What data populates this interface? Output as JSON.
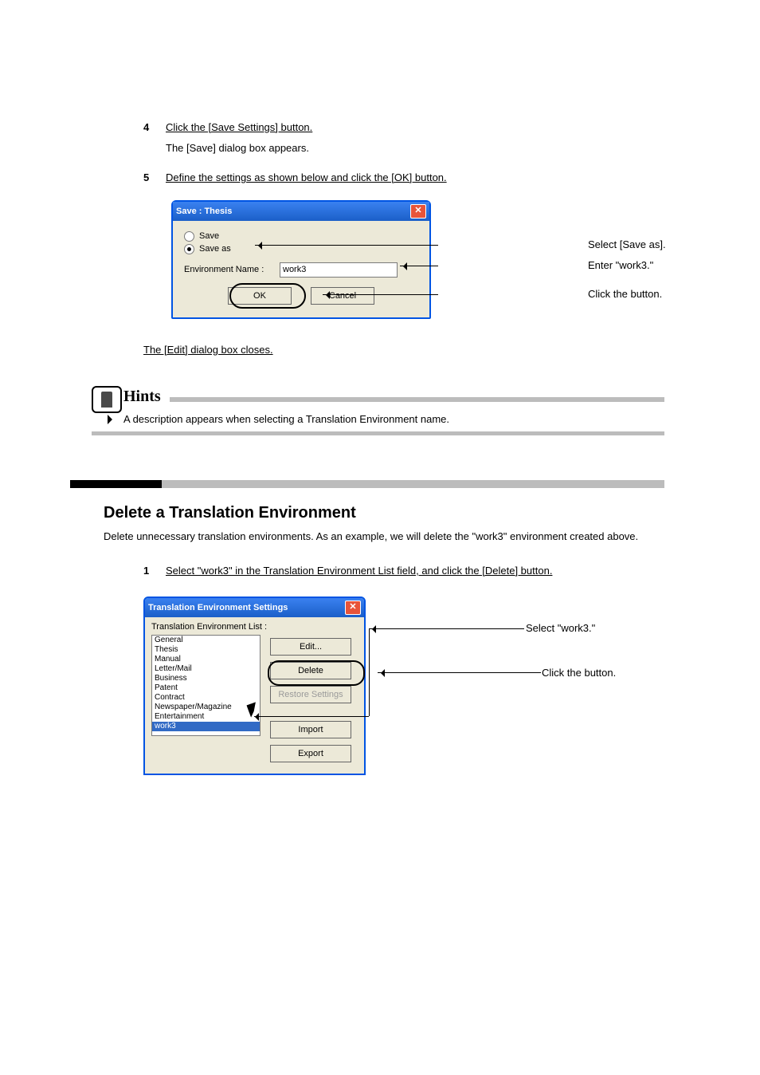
{
  "step4": {
    "num": "4",
    "text": "Click the [Save Settings] button.",
    "after": "The [Save] dialog box appears."
  },
  "step5": {
    "num": "5",
    "text": "Define the settings as shown below and click the [OK] button."
  },
  "save_dialog": {
    "title": "Save : Thesis",
    "radio_save": "Save",
    "radio_saveas": "Save as",
    "env_name_label": "Environment Name :",
    "env_name_value": "work3",
    "ok": "OK",
    "cancel": "Cancel"
  },
  "callouts": {
    "select_saveas": "Select [Save as].",
    "enter_work3": "Enter \"work3.\"",
    "click_ok": "Click the button."
  },
  "step4_close": "The [Edit] dialog box closes.",
  "hints_label": "Hints",
  "hints_text": "A description appears when selecting a Translation Environment name.",
  "section_title": "Delete a Translation Environment",
  "section_para": "Delete unnecessary translation environments. As an example, we will delete the \"work3\" environment created above.",
  "step1_delete": {
    "num": "1",
    "text": "Select \"work3\" in the Translation Environment List field, and click the [Delete] button."
  },
  "settings_dialog": {
    "title": "Translation Environment Settings",
    "list_label": "Translation Environment List :",
    "items": [
      "General",
      "Thesis",
      "Manual",
      "Letter/Mail",
      "Business",
      "Patent",
      "Contract",
      "Newspaper/Magazine",
      "Entertainment",
      "work3"
    ],
    "selected": "work3",
    "edit": "Edit...",
    "delete": "Delete",
    "restore": "Restore Settings",
    "import": "Import",
    "export": "Export"
  },
  "callouts2": {
    "select_work3": "Select \"work3.\"",
    "click_button": "Click the button."
  }
}
